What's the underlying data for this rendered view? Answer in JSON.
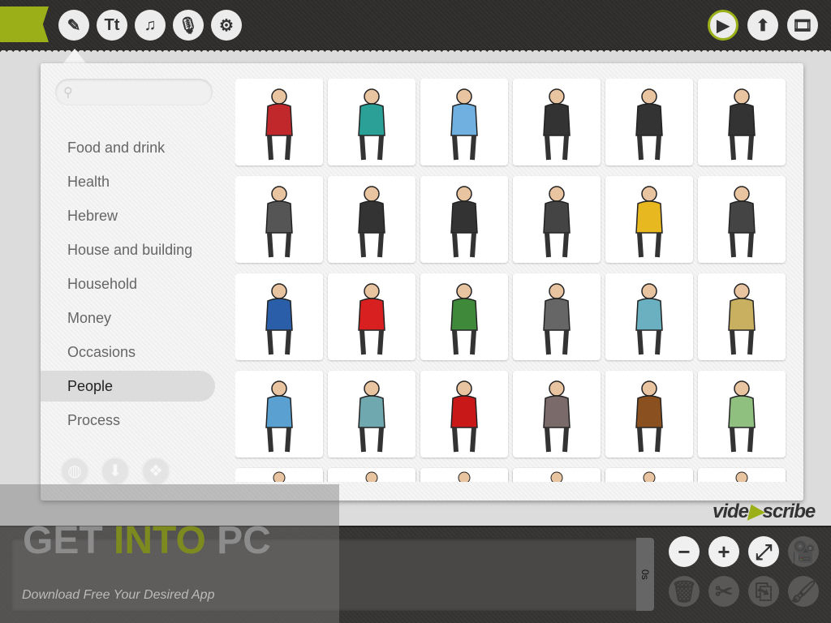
{
  "toolbar": {
    "left": [
      {
        "icon": "pencil-icon",
        "glyph": "✎"
      },
      {
        "icon": "text-icon",
        "glyph": "Tt"
      },
      {
        "icon": "music-icon",
        "glyph": "♫"
      },
      {
        "icon": "microphone-icon",
        "glyph": "🎙"
      },
      {
        "icon": "settings-icon",
        "glyph": "⚙"
      }
    ],
    "right": [
      {
        "icon": "play-icon",
        "glyph": "▶"
      },
      {
        "icon": "upload-icon",
        "glyph": "⬆"
      },
      {
        "icon": "film-icon",
        "glyph": "🎞"
      }
    ]
  },
  "accent": "#9bb018",
  "search": {
    "placeholder": "",
    "value": ""
  },
  "categories": [
    "Food and drink",
    "Health",
    "Hebrew",
    "House and building",
    "Household",
    "Money",
    "Occasions",
    "People",
    "Process"
  ],
  "selected_category": "People",
  "source_icons": [
    "globe-icon",
    "download-icon",
    "dropbox-icon"
  ],
  "thumbnail_colors": [
    "#c0282c",
    "#2aa096",
    "#6fb0e0",
    "#333333",
    "#333333",
    "#333333",
    "#555555",
    "#333333",
    "#333333",
    "#444444",
    "#e8b820",
    "#444444",
    "#2a5ea8",
    "#d82020",
    "#3e8a3a",
    "#666666",
    "#6ab0c0",
    "#c8b060",
    "#5aa0d0",
    "#70a8b0",
    "#c81818",
    "#7a6a6a",
    "#8a5020",
    "#90c080",
    "#777777",
    "#8060a0",
    "#e0c090",
    "#6a4a3a",
    "#e0c020",
    "#e8d090"
  ],
  "logo": {
    "pre": "vide",
    "mark": "▶",
    "post": "scribe"
  },
  "timeline": {
    "time": "0s"
  },
  "bottom_buttons": [
    {
      "icon": "zoom-out-icon",
      "glyph": "−",
      "enabled": true
    },
    {
      "icon": "zoom-in-icon",
      "glyph": "+",
      "enabled": true
    },
    {
      "icon": "zoom-fit-icon",
      "glyph": "⤢",
      "enabled": true
    },
    {
      "icon": "camera-icon",
      "glyph": "🎥",
      "enabled": false
    },
    {
      "icon": "trash-icon",
      "glyph": "🗑",
      "enabled": false
    },
    {
      "icon": "scissors-icon",
      "glyph": "✂",
      "enabled": false
    },
    {
      "icon": "copy-icon",
      "glyph": "⎘",
      "enabled": false
    },
    {
      "icon": "brush-icon",
      "glyph": "🖌",
      "enabled": false
    }
  ],
  "watermark": {
    "a": "GET ",
    "b": "INTO",
    "c": " PC",
    "sub": "Download Free Your Desired App"
  }
}
